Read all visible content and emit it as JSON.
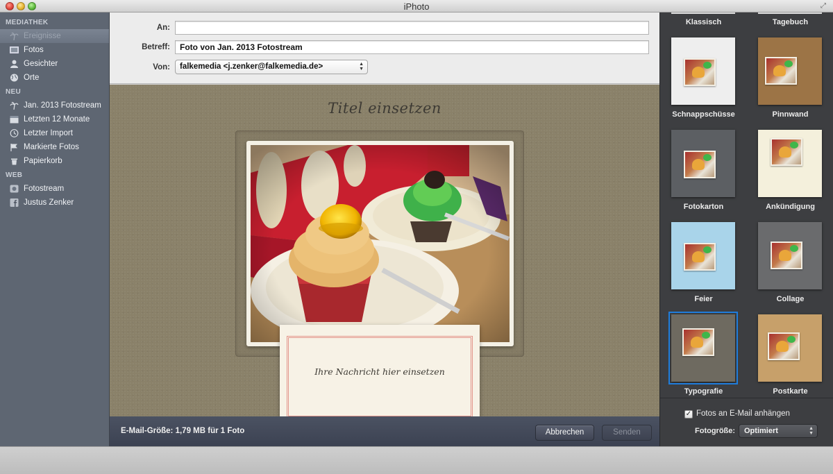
{
  "window": {
    "title": "iPhoto"
  },
  "sidebar": {
    "sections": [
      {
        "label": "MEDIATHEK",
        "items": [
          {
            "label": "Ereignisse",
            "icon": "palm-tree-icon",
            "selected": true
          },
          {
            "label": "Fotos",
            "icon": "photos-icon"
          },
          {
            "label": "Gesichter",
            "icon": "person-icon"
          },
          {
            "label": "Orte",
            "icon": "globe-icon"
          }
        ]
      },
      {
        "label": "NEU",
        "items": [
          {
            "label": "Jan. 2013 Fotostream",
            "icon": "palm-tree-icon"
          },
          {
            "label": "Letzten 12 Monate",
            "icon": "calendar-icon"
          },
          {
            "label": "Letzter Import",
            "icon": "clock-icon"
          },
          {
            "label": "Markierte Fotos",
            "icon": "flag-icon"
          },
          {
            "label": "Papierkorb",
            "icon": "trash-icon"
          }
        ]
      },
      {
        "label": "WEB",
        "items": [
          {
            "label": "Fotostream",
            "icon": "photostream-icon"
          },
          {
            "label": "Justus Zenker",
            "icon": "facebook-icon"
          }
        ]
      }
    ]
  },
  "email": {
    "to_label": "An:",
    "to_value": "",
    "subject_label": "Betreff:",
    "subject_value": "Foto von Jan. 2013 Fotostream",
    "from_label": "Von:",
    "from_value": "falkemedia <j.zenker@falkemedia.de>"
  },
  "card": {
    "title": "Titel einsetzen",
    "message": "Ihre Nachricht hier einsetzen"
  },
  "footer": {
    "size_text": "E-Mail-Größe: 1,79 MB für 1 Foto",
    "cancel_label": "Abbrechen",
    "send_label": "Senden"
  },
  "themes": {
    "top_row": [
      "Klassisch",
      "Tagebuch"
    ],
    "items": [
      {
        "label": "Schnappschüsse",
        "bg": "#eeeeee"
      },
      {
        "label": "Pinnwand",
        "bg": "#9c7446"
      },
      {
        "label": "Fotokarton",
        "bg": "#5c5f63"
      },
      {
        "label": "Ankündigung",
        "bg": "#f4f0dc"
      },
      {
        "label": "Feier",
        "bg": "#a9d4ea"
      },
      {
        "label": "Collage",
        "bg": "#6a6b6d"
      },
      {
        "label": "Typografie",
        "bg": "#6e6a60",
        "selected": true
      },
      {
        "label": "Postkarte",
        "bg": "#c7a06a"
      }
    ],
    "attach_label": "Fotos an E-Mail anhängen",
    "attach_checked": true,
    "photo_size_label": "Fotogröße:",
    "photo_size_value": "Optimiert"
  },
  "colors": {
    "selection": "#1f7ddc",
    "sidebar_bg": "#5e6672",
    "canvas_bg": "#8a8169"
  }
}
